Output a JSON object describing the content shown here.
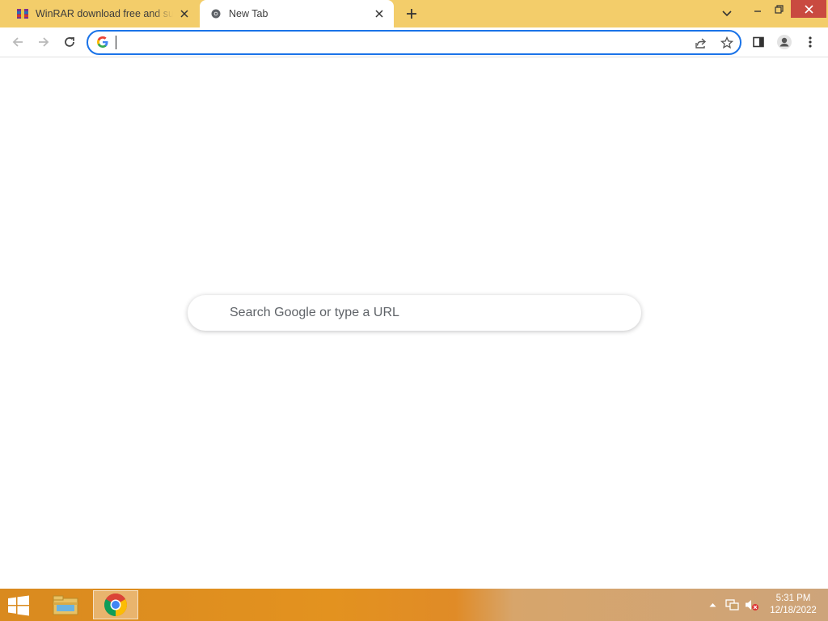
{
  "browser": {
    "tabs": [
      {
        "title": "WinRAR download free and support: WinRAR",
        "favicon": "winrar-icon",
        "active": false
      },
      {
        "title": "New Tab",
        "favicon": "chrome-newtab-icon",
        "active": true
      }
    ],
    "omnibox": {
      "value": "",
      "placeholder": ""
    }
  },
  "new_tab_page": {
    "search_placeholder": "Search Google or type a URL"
  },
  "taskbar": {
    "items": [
      "file-explorer-icon",
      "chrome-icon"
    ],
    "clock": {
      "time": "5:31 PM",
      "date": "12/18/2022"
    }
  },
  "colors": {
    "tabstrip": "#f3cd6a",
    "accent": "#1a73e8",
    "close_button": "#c94a40"
  }
}
